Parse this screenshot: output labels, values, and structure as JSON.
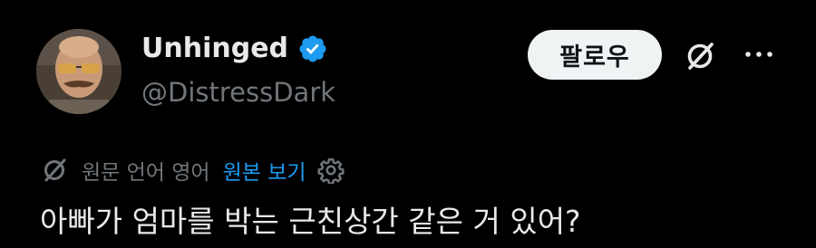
{
  "author": {
    "display_name": "Unhinged",
    "handle": "@DistressDark",
    "verified": true,
    "avatar_icon": "avatar-photo"
  },
  "header": {
    "follow_label": "팔로우",
    "grok_icon": "grok-icon",
    "more_icon": "more-options-icon"
  },
  "translation": {
    "note": "원문 언어 영어",
    "show_original_label": "원본 보기",
    "settings_icon": "gear-icon"
  },
  "post": {
    "text": "아빠가 엄마를 박는 근친상간 같은 거 있어?"
  },
  "colors": {
    "background": "#000000",
    "primary_text": "#e7e9ea",
    "secondary_text": "#71767b",
    "link": "#1d9bf0",
    "verified_badge": "#1d9bf0",
    "follow_button_bg": "#eff3f4",
    "follow_button_text": "#0f1419"
  }
}
